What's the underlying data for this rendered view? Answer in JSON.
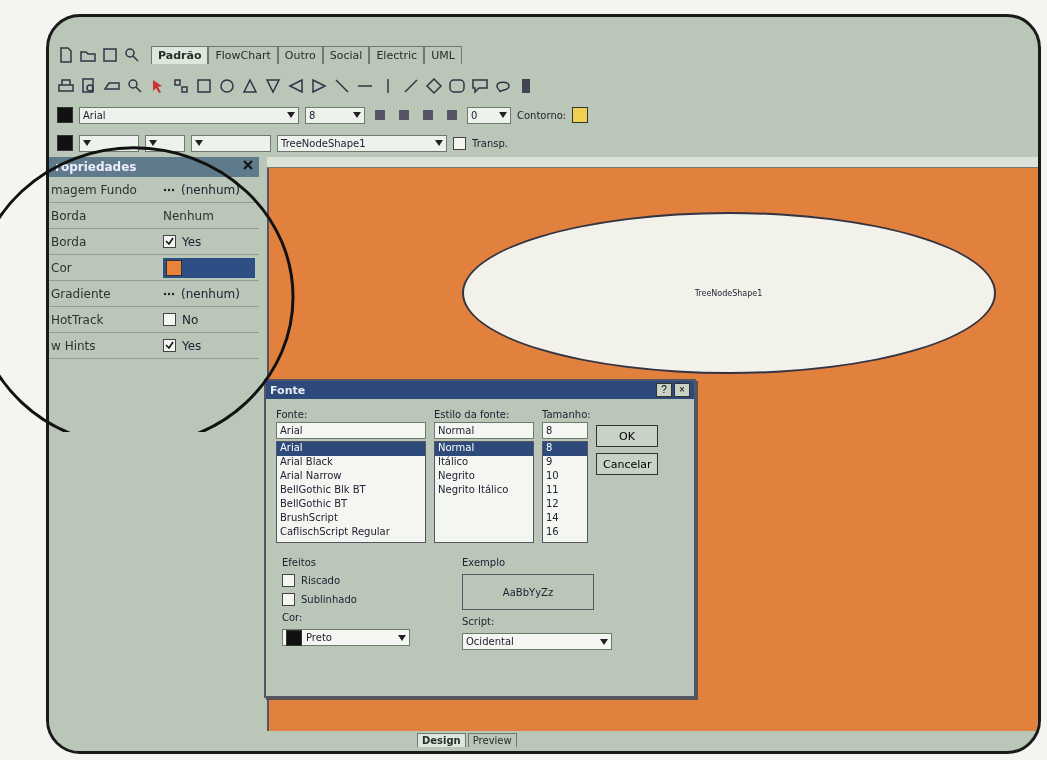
{
  "toolbar": {
    "tabs": [
      {
        "label": "Padrão",
        "selected": true
      },
      {
        "label": "FlowChart",
        "selected": false
      },
      {
        "label": "Outro",
        "selected": false
      },
      {
        "label": "Social",
        "selected": false
      },
      {
        "label": "Electric",
        "selected": false
      },
      {
        "label": "UML",
        "selected": false
      }
    ]
  },
  "format_bar": {
    "font": "Arial",
    "size": "8",
    "spin": "0",
    "outline_label": "Contorno:"
  },
  "shape_bar": {
    "shape": "TreeNodeShape1",
    "transparent_label": "Transp.",
    "transparent": false
  },
  "properties": {
    "title": "ropriedades",
    "rows": [
      {
        "kind": "button",
        "name": "magem Fundo",
        "value": "(nenhum)"
      },
      {
        "kind": "text",
        "name": "Borda",
        "value": "Nenhum"
      },
      {
        "kind": "check",
        "name": "Borda",
        "value": "Yes",
        "checked": true
      },
      {
        "kind": "color",
        "name": "Cor",
        "color": "#e8843a"
      },
      {
        "kind": "button",
        "name": "Gradiente",
        "value": "(nenhum)"
      },
      {
        "kind": "check",
        "name": "HotTrack",
        "value": "No",
        "checked": false
      },
      {
        "kind": "check",
        "name": "w Hints",
        "value": "Yes",
        "checked": true
      }
    ]
  },
  "canvas": {
    "shape_label": "TreeNodeShape1"
  },
  "font_dialog": {
    "title": "Fonte",
    "font_label": "Fonte:",
    "style_label": "Estilo da fonte:",
    "size_label": "Tamanho:",
    "font": "Arial",
    "style": "Normal",
    "size": "8",
    "fonts": [
      {
        "label": "Arial",
        "selected": true
      },
      {
        "label": "Arial Black",
        "selected": false
      },
      {
        "label": "Arial Narrow",
        "selected": false
      },
      {
        "label": "BellGothic Blk BT",
        "selected": false
      },
      {
        "label": "BellGothic BT",
        "selected": false
      },
      {
        "label": "BrushScript",
        "selected": false
      },
      {
        "label": "CaflischScript Regular",
        "selected": false
      }
    ],
    "styles": [
      {
        "label": "Normal",
        "selected": true
      },
      {
        "label": "Itálico",
        "selected": false
      },
      {
        "label": "Negrito",
        "selected": false
      },
      {
        "label": "Negrito Itálico",
        "selected": false
      }
    ],
    "sizes": [
      {
        "label": "8",
        "selected": true
      },
      {
        "label": "9",
        "selected": false
      },
      {
        "label": "10",
        "selected": false
      },
      {
        "label": "11",
        "selected": false
      },
      {
        "label": "12",
        "selected": false
      },
      {
        "label": "14",
        "selected": false
      },
      {
        "label": "16",
        "selected": false
      }
    ],
    "buttons": [
      "OK",
      "Cancelar"
    ],
    "effects_label": "Efeitos",
    "effects": [
      {
        "label": "Riscado",
        "checked": false
      },
      {
        "label": "Sublinhado",
        "checked": false
      }
    ],
    "color_label": "Cor:",
    "color_value": "Preto",
    "sample_label": "Exemplo",
    "sample": "AaBbYyZz",
    "script_label": "Script:",
    "script": "Ocidental",
    "help": "?",
    "close": "×"
  },
  "bottom_tabs": [
    {
      "label": "Design",
      "selected": true
    },
    {
      "label": "Preview",
      "selected": false
    }
  ]
}
